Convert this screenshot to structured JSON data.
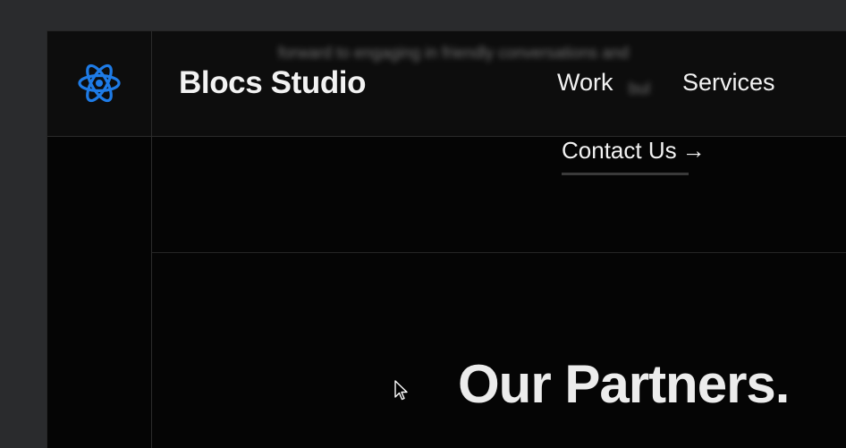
{
  "header": {
    "brand": "Blocs Studio",
    "logo_icon": "atom-icon",
    "blurred_text_line1": "forward to engaging in friendly conversations and",
    "blurred_text_line2": "bul"
  },
  "nav": {
    "items": [
      {
        "label": "Work"
      },
      {
        "label": "Services"
      }
    ],
    "contact_label": "Contact Us",
    "contact_arrow": "→"
  },
  "main": {
    "headline": "Our Partners."
  },
  "colors": {
    "accent": "#1e7be6",
    "background": "#050505",
    "text": "#f2f2f2",
    "window_bg": "#2a2b2d"
  }
}
